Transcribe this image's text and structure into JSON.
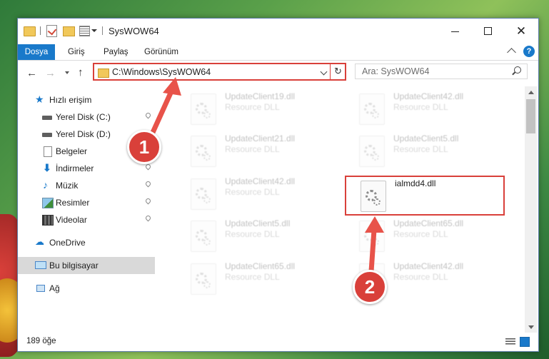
{
  "window": {
    "title": "SysWOW64",
    "accent_color": "#1979ca",
    "highlight_color": "#d9403a"
  },
  "ribbon": {
    "tabs": [
      "Dosya",
      "Giriş",
      "Paylaş",
      "Görünüm"
    ],
    "help_label": "?"
  },
  "address": {
    "path": "C:\\Windows\\SysWOW64",
    "search_placeholder": "Ara: SysWOW64"
  },
  "sidebar": {
    "items": [
      {
        "label": "Hızlı erişim",
        "icon": "star-icon"
      },
      {
        "label": "Yerel Disk (C:)",
        "icon": "drive-icon",
        "pinned": true
      },
      {
        "label": "Yerel Disk (D:)",
        "icon": "drive-icon"
      },
      {
        "label": "Belgeler",
        "icon": "documents-icon"
      },
      {
        "label": "İndirmeler",
        "icon": "download-icon",
        "pinned": true
      },
      {
        "label": "Müzik",
        "icon": "music-icon",
        "pinned": true
      },
      {
        "label": "Resimler",
        "icon": "pictures-icon",
        "pinned": true
      },
      {
        "label": "Videolar",
        "icon": "videos-icon",
        "pinned": true
      },
      {
        "label": "OneDrive",
        "icon": "cloud-icon"
      },
      {
        "label": "Bu bilgisayar",
        "icon": "computer-icon",
        "selected": true
      },
      {
        "label": "Ağ",
        "icon": "network-icon"
      }
    ]
  },
  "files": [
    {
      "name": "UpdateClient19.dll",
      "type": "Resource DLL",
      "faded": true
    },
    {
      "name": "UpdateClient42.dll",
      "type": "Resource DLL",
      "faded": true
    },
    {
      "name": "UpdateClient21.dll",
      "type": "Resource DLL",
      "faded": true
    },
    {
      "name": "UpdateClient5.dll",
      "type": "Resource DLL",
      "faded": true
    },
    {
      "name": "UpdateClient42.dll",
      "type": "Resource DLL",
      "faded": true
    },
    {
      "name": "ialmdd4.dll",
      "type": "",
      "faded": false
    },
    {
      "name": "UpdateClient5.dll",
      "type": "Resource DLL",
      "faded": true
    },
    {
      "name": "UpdateClient65.dll",
      "type": "Resource DLL",
      "faded": true
    },
    {
      "name": "UpdateClient65.dll",
      "type": "Resource DLL",
      "faded": true
    },
    {
      "name": "UpdateClient42.dll",
      "type": "Resource DLL",
      "faded": true
    }
  ],
  "status": {
    "item_count": "189 öğe"
  },
  "annotations": {
    "step1": "1",
    "step2": "2"
  }
}
